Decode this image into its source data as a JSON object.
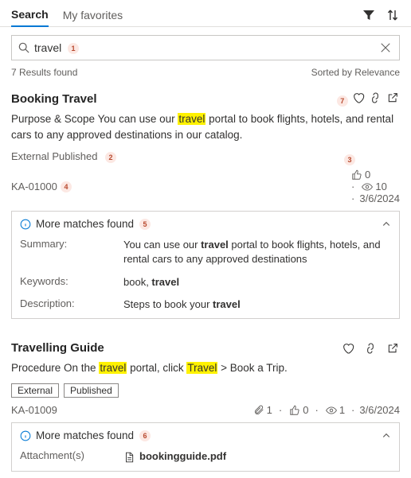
{
  "tabs": {
    "search": "Search",
    "favorites": "My favorites"
  },
  "search": {
    "value": "travel"
  },
  "meta": {
    "count_text": "7 Results found",
    "sort_text": "Sorted by Relevance"
  },
  "markers": {
    "m1": "1",
    "m2": "2",
    "m3": "3",
    "m4": "4",
    "m5": "5",
    "m6": "6",
    "m7": "7"
  },
  "results": [
    {
      "title": "Booking Travel",
      "snippet_pre": "Purpose & Scope You can use our ",
      "snippet_hl1": "travel",
      "snippet_post": " portal to book flights, hotels, and rental cars to any approved destinations in our catalog.",
      "badge1": "External",
      "badge2": "Published",
      "id": "KA-01000",
      "likes": "0",
      "views": "10",
      "date": "3/6/2024",
      "panel_label": "More matches found",
      "summary_k": "Summary:",
      "summary_v_pre": "You can use our ",
      "summary_v_b": "travel",
      "summary_v_post": " portal to book flights, hotels, and rental cars to any approved destinations",
      "keywords_k": "Keywords:",
      "keywords_v_pre": "book, ",
      "keywords_v_b": "travel",
      "desc_k": "Description:",
      "desc_v_pre": "Steps to book your ",
      "desc_v_b": "travel"
    },
    {
      "title": "Travelling Guide",
      "snippet_pre": "Procedure On the ",
      "snippet_hl1": "travel",
      "snippet_mid": " portal, click ",
      "snippet_hl2": "Travel",
      "snippet_post": " > Book a Trip.",
      "badge1": "External",
      "badge2": "Published",
      "id": "KA-01009",
      "attach_count": "1",
      "likes": "0",
      "views": "1",
      "date": "3/6/2024",
      "panel_label": "More matches found",
      "attach_k": "Attachment(s)",
      "attach_v": "bookingguide.pdf"
    }
  ]
}
